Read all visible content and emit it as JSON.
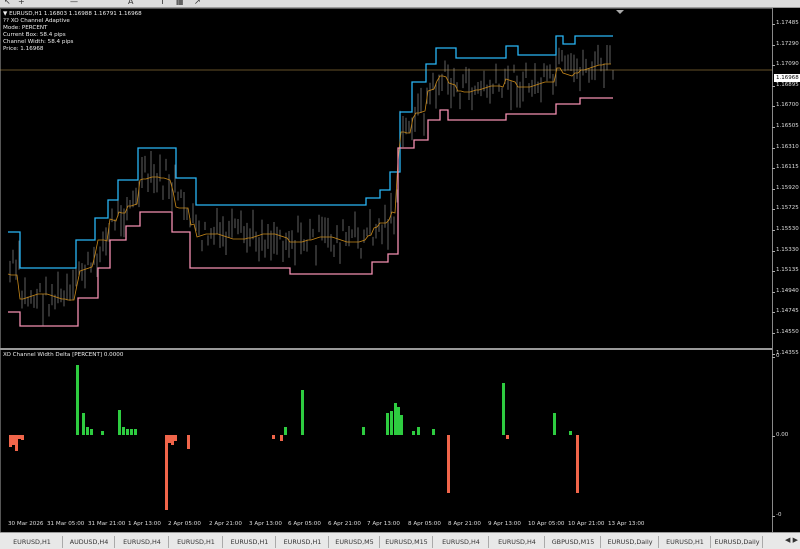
{
  "symbol_header": "EURUSD,H1  1.16803 1.16988 1.16791 1.16968",
  "indicator": {
    "name": "?? XO Channel Adaptive",
    "mode": "Mode: PERCENT",
    "current_box": "Current Box: 58.4 pips",
    "channel_width": "Channel Width: 58.4 pips",
    "price": "Price: 1.16968"
  },
  "current_price": "1.16968",
  "price_ticks": [
    "1.17485",
    "1.17290",
    "1.17090",
    "1.16895",
    "1.16700",
    "1.16505",
    "1.16310",
    "1.16115",
    "1.15920",
    "1.15725",
    "1.15530",
    "1.15330",
    "1.15135",
    "1.14940",
    "1.14745",
    "1.14550",
    "1.14355"
  ],
  "subwindow": {
    "title": "XO Channel Width Delta [PERCENT] 0.0000",
    "ticks": [
      "0",
      "0.00",
      "-0"
    ]
  },
  "time_labels": [
    "30 Mar 2026",
    "31 Mar 05:00",
    "31 Mar 21:00",
    "1 Apr 13:00",
    "2 Apr 05:00",
    "2 Apr 21:00",
    "3 Apr 13:00",
    "6 Apr 05:00",
    "6 Apr 21:00",
    "7 Apr 13:00",
    "8 Apr 05:00",
    "8 Apr 21:00",
    "9 Apr 13:00",
    "10 Apr 05:00",
    "10 Apr 21:00",
    "13 Apr 13:00"
  ],
  "tabs": [
    "EURUSD,H1",
    "AUDUSD,H4",
    "EURUSD,H4",
    "EURUSD,H1",
    "EURUSD,H1",
    "EURUSD,H1",
    "EURUSD,M5",
    "EURUSD,M15",
    "EURUSD,H4",
    "EURUSD,H4",
    "GBPUSD,M15",
    "EURUSD,Daily",
    "EURUSD,H1",
    "EURUSD,Daily"
  ],
  "tab_arrows": "◀ ▶",
  "colors": {
    "upper_band": "#29b6f6",
    "mid_band": "#c8891a",
    "lower_band": "#f48fb1",
    "candles": "#8a8a8a",
    "delta_positive": "#2ecc40",
    "delta_negative": "#f0654a",
    "price_line": "#c8a050"
  }
}
